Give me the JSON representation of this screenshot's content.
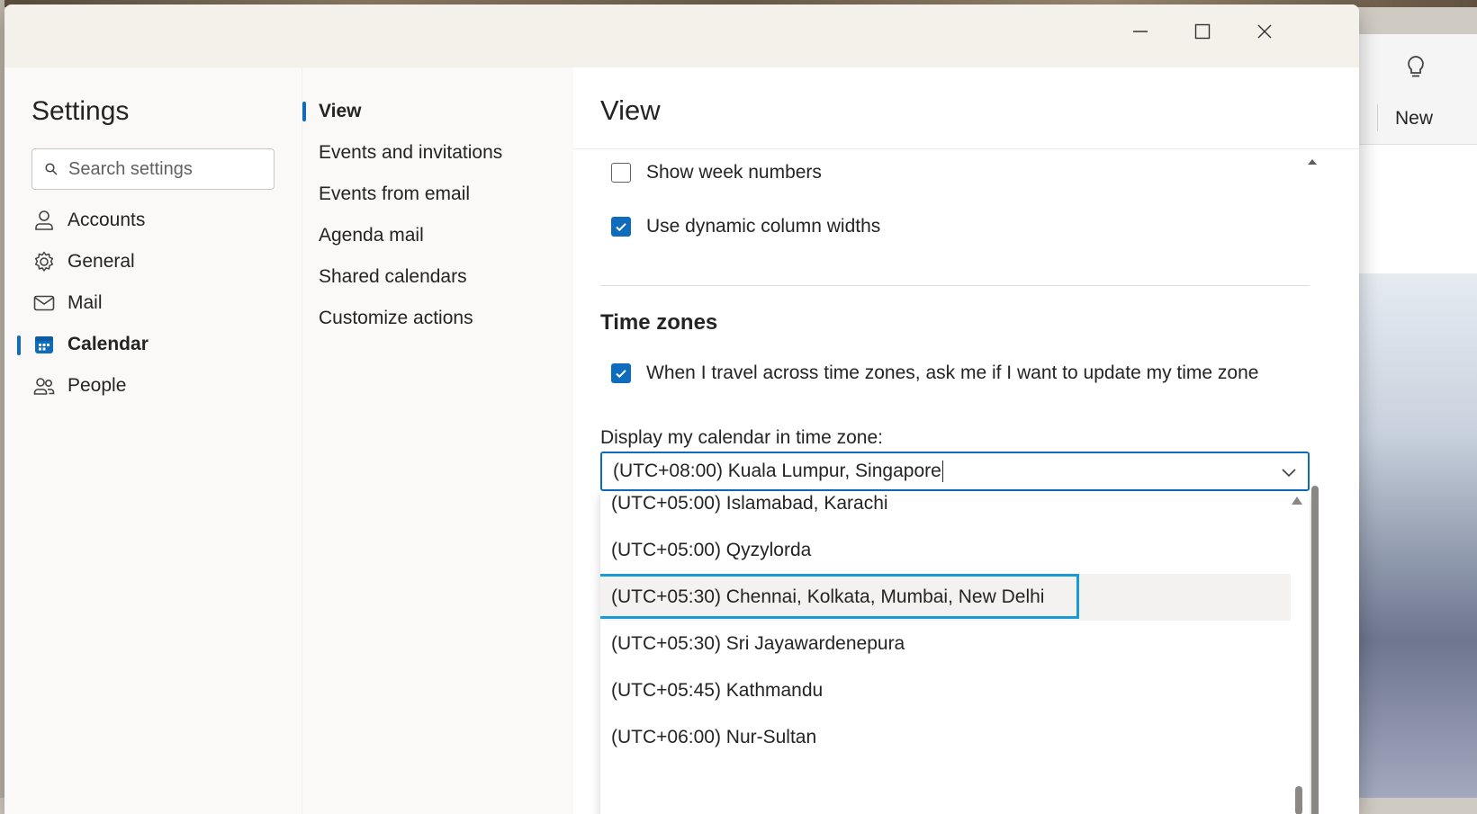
{
  "window": {
    "minimize_icon": "minimize-icon",
    "maximize_icon": "maximize-icon",
    "close_icon": "close-icon"
  },
  "background_app": {
    "new_label": "New"
  },
  "settings": {
    "title": "Settings",
    "search": {
      "placeholder": "Search settings",
      "value": ""
    },
    "nav": [
      {
        "label": "Accounts",
        "icon": "person-icon"
      },
      {
        "label": "General",
        "icon": "gear-icon"
      },
      {
        "label": "Mail",
        "icon": "mail-icon"
      },
      {
        "label": "Calendar",
        "icon": "calendar-icon",
        "selected": true
      },
      {
        "label": "People",
        "icon": "people-icon"
      }
    ]
  },
  "calendar_nav": [
    {
      "label": "View",
      "selected": true
    },
    {
      "label": "Events and invitations"
    },
    {
      "label": "Events from email"
    },
    {
      "label": "Agenda mail"
    },
    {
      "label": "Shared calendars"
    },
    {
      "label": "Customize actions"
    }
  ],
  "view": {
    "title": "View",
    "options": [
      {
        "label": "Show week numbers",
        "checked": false
      },
      {
        "label": "Use dynamic column widths",
        "checked": true
      }
    ],
    "time_zones": {
      "title": "Time zones",
      "travel_option": {
        "label": "When I travel across time zones, ask me if I want to update my time zone",
        "checked": true
      },
      "display_label": "Display my calendar in time zone:",
      "selected_value": "(UTC+08:00) Kuala Lumpur, Singapore",
      "dropdown_options": [
        "(UTC+05:00) Islamabad, Karachi",
        "(UTC+05:00) Qyzylorda",
        "(UTC+05:30) Chennai, Kolkata, Mumbai, New Delhi",
        "(UTC+05:30) Sri Jayawardenepura",
        "(UTC+05:45) Kathmandu",
        "(UTC+06:00) Nur-Sultan"
      ],
      "highlighted_option": "(UTC+05:30) Chennai, Kolkata, Mumbai, New Delhi"
    }
  },
  "colors": {
    "accent": "#0f6cbd",
    "focus_ring": "#1a9ad6",
    "titlebar": "#f4f0ea",
    "nav_background": "#faf9f8"
  }
}
